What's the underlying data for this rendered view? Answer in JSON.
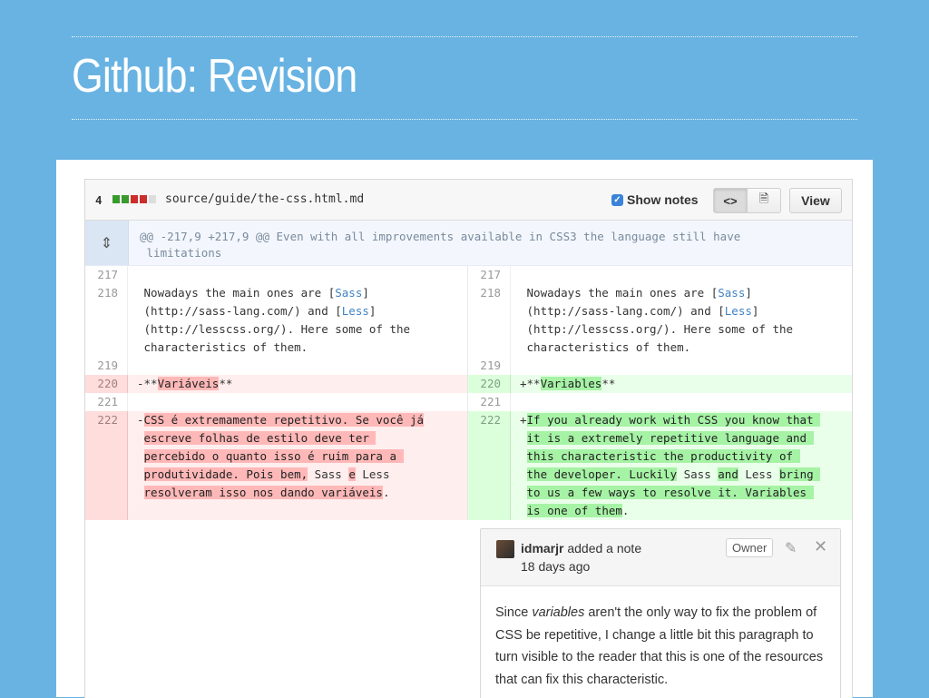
{
  "slide": {
    "title": "Github: Revision"
  },
  "file": {
    "count": "4",
    "path": "source/guide/the-css.html.md",
    "show_notes_label": "Show notes",
    "view_label": "View",
    "hunk": "@@ -217,9 +217,9 @@ Even with all improvements available in CSS3 the language still have\n limitations"
  },
  "colors": {
    "background": "#69b3e3",
    "deletion": "#ffeeee",
    "addition": "#eaffea",
    "link": "#4183c4"
  },
  "left": {
    "lines": [
      {
        "n": "217",
        "t": "",
        "type": "ctx",
        "h": 20
      },
      {
        "n": "218",
        "t": "",
        "type": "ctx",
        "h": 80,
        "html": " Nowadays the main ones are [<span class=\"link\">Sass</span>]\n (http://sass-lang.com/) and [<span class=\"link\">Less</span>]\n (http://lesscss.org/). Here some of the\n characteristics of them."
      },
      {
        "n": "219",
        "t": "",
        "type": "ctx",
        "h": 20
      },
      {
        "n": "220",
        "t": "",
        "type": "del",
        "h": 20,
        "html": "-**<mark class=\"d\">Variáveis</mark>**"
      },
      {
        "n": "221",
        "t": "",
        "type": "ctx",
        "h": 20
      },
      {
        "n": "222",
        "t": "",
        "type": "del",
        "h": 120,
        "html": "-<mark class=\"d\">CSS é extremamente repetitivo. Se você já</mark>\n <mark class=\"d\">escreve folhas de estilo deve ter </mark>\n <mark class=\"d\">percebido o quanto isso é ruim para a </mark>\n <mark class=\"d\">produtividade. Pois bem,</mark> Sass <mark class=\"d\">e</mark> Less\n <mark class=\"d\">resolveram isso nos dando variáveis</mark>."
      }
    ]
  },
  "right": {
    "lines": [
      {
        "n": "217",
        "type": "ctx",
        "h": 20
      },
      {
        "n": "218",
        "type": "ctx",
        "h": 80,
        "html": " Nowadays the main ones are [<span class=\"link\">Sass</span>]\n (http://sass-lang.com/) and [<span class=\"link\">Less</span>]\n (http://lesscss.org/). Here some of the\n characteristics of them."
      },
      {
        "n": "219",
        "type": "ctx",
        "h": 20
      },
      {
        "n": "220",
        "type": "add",
        "h": 20,
        "html": "+**<mark class=\"a\">Variables</mark>**"
      },
      {
        "n": "221",
        "type": "ctx",
        "h": 20
      },
      {
        "n": "222",
        "type": "add",
        "h": 120,
        "html": "+<mark class=\"a\">If you already work with CSS you know that </mark>\n <mark class=\"a\">it is a extremely repetitive language and </mark>\n <mark class=\"a\">this characteristic the productivity of </mark>\n <mark class=\"a\">the developer. Luckily</mark> Sass <mark class=\"a\">and</mark> Less <mark class=\"a\">bring </mark>\n <mark class=\"a\">to us a few ways to resolve it. Variables </mark>\n <mark class=\"a\">is one of them</mark>."
      }
    ]
  },
  "note": {
    "author": "idmarjr",
    "action": "added a note",
    "time": "18 days ago",
    "badge": "Owner",
    "body_html": "Since <i>variables</i> aren't the only way to fix the problem of CSS be repetitive, I change a little bit this paragraph to turn visible to the reader that this is one of the resources that can fix this characteristic."
  }
}
